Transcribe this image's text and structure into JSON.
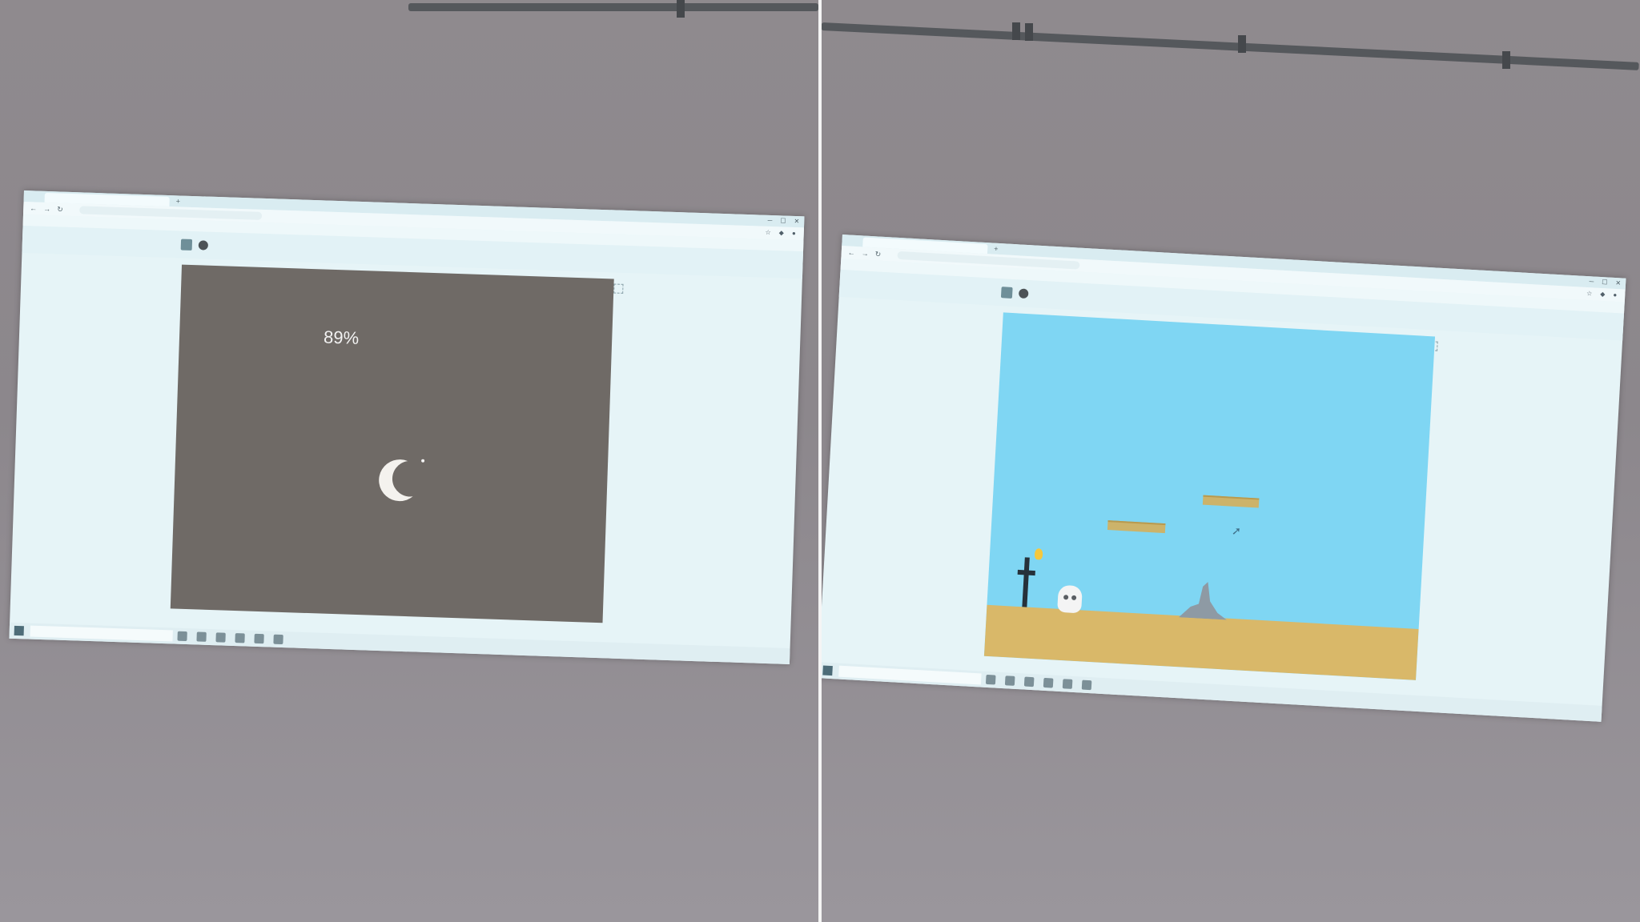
{
  "panels": [
    {
      "id": "loading",
      "browser": {
        "tab_title": "",
        "url": "",
        "bookmarks": [],
        "zoom_label": ""
      },
      "loading_screen": {
        "progress_text": "89%",
        "progress_value": 0.89,
        "background_color": "#6f6a66",
        "spinner_icon": "crescent-moon-icon"
      }
    },
    {
      "id": "game",
      "browser": {
        "tab_title": "",
        "url": "",
        "bookmarks": [],
        "zoom_label": ""
      },
      "game_scene": {
        "sky_color": "#7fd6f3",
        "ground_color": "#d9b869",
        "objects": [
          "torch-cross",
          "skull-character",
          "floating-platform",
          "floating-platform",
          "rock-spire",
          "mouse-cursor"
        ]
      }
    }
  ]
}
